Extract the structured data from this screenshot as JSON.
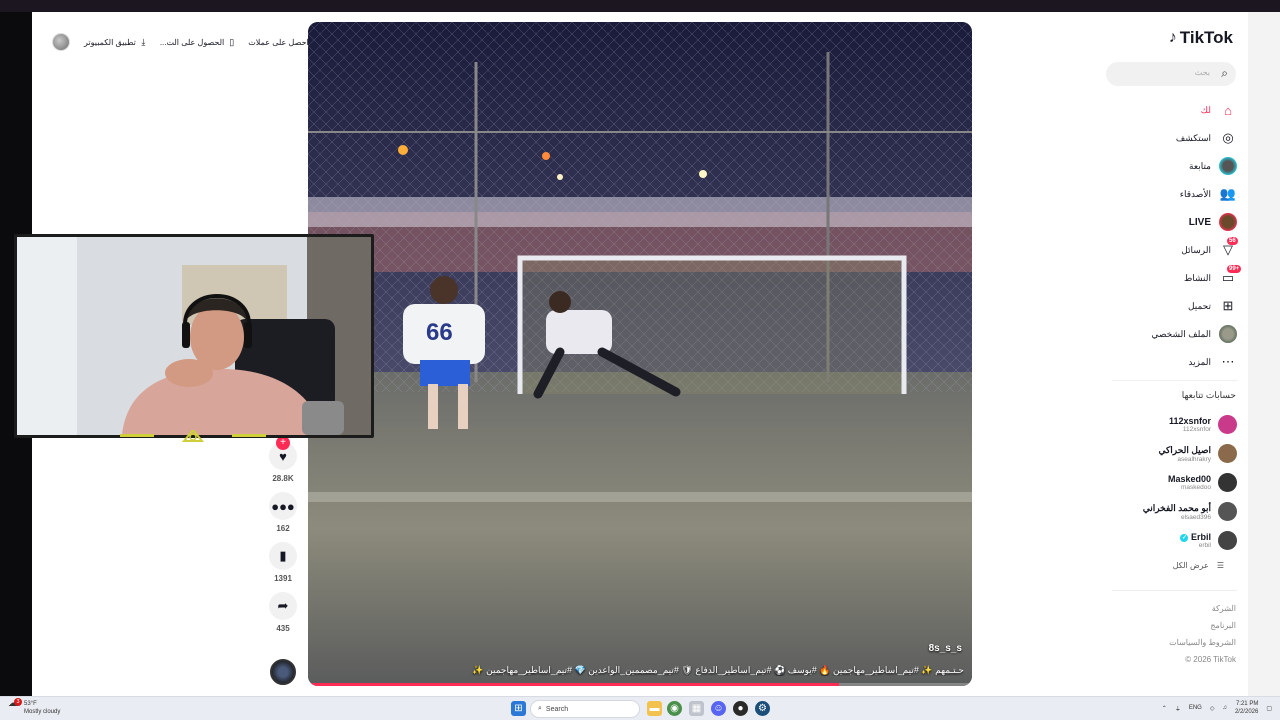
{
  "promo": {
    "get_coins": "احصل على عملات",
    "get_app": "الحصول على الت...",
    "desktop_app": "تطبيق الكمبيوتر"
  },
  "video": {
    "author": "8s_s_s",
    "caption": "حـتـمهم ✨ #تيم_اساطير_مهاجمين 🔥 #يوسف ⚽ #تيم_اساطير_الدفاع 🛡 #تيم_مصممين_الواعدين 💎 #تيم_اساطير_مهاجمين ✨",
    "progress": 0.8,
    "jersey_number": "66"
  },
  "actions": {
    "likes": "28.8K",
    "comments": "162",
    "saves": "1391",
    "shares": "435"
  },
  "sidebar": {
    "logo": "TikTok",
    "search_placeholder": "بحث",
    "nav": [
      {
        "label": "لك",
        "icon": "home-icon"
      },
      {
        "label": "استكشف",
        "icon": "compass-icon"
      },
      {
        "label": "متابعة",
        "icon": "following-avatar-icon"
      },
      {
        "label": "الأصدقاء",
        "icon": "friends-icon"
      },
      {
        "label": "LIVE",
        "icon": "live-icon"
      },
      {
        "label": "الرسائل",
        "icon": "messages-icon",
        "badge": "56"
      },
      {
        "label": "النشاط",
        "icon": "activity-icon",
        "badge": "99+"
      },
      {
        "label": "تحميل",
        "icon": "upload-icon"
      },
      {
        "label": "الملف الشخصي",
        "icon": "profile-icon"
      },
      {
        "label": "المزيد",
        "icon": "more-icon"
      }
    ],
    "following_title": "حسابات تتابعها",
    "accounts": [
      {
        "name": "112xsnfor",
        "handle": "112xsnfor",
        "color": "#c93a8a"
      },
      {
        "name": "اصيل الحراكي",
        "handle": "asealhrakry",
        "color": "#8a6a4a"
      },
      {
        "name": "Masked00",
        "handle": "maskedoo",
        "color": "#333333"
      },
      {
        "name": "أبو محمد الفخراني",
        "handle": "elsaed396",
        "color": "#555555"
      },
      {
        "name": "Erbil",
        "handle": "erbil",
        "color": "#444444"
      }
    ],
    "see_all": "عرض الكل",
    "footer": [
      "الشركة",
      "البرنامج",
      "الشروط والسياسات",
      "© 2026 TikTok"
    ]
  },
  "taskbar": {
    "temperature": "53°F",
    "weather": "Mostly cloudy",
    "weather_badge": "3",
    "search": "Search",
    "lang": "ENG",
    "time": "7:21 PM",
    "date": "2/2/2026"
  },
  "colors": {
    "brand": "#fe2c55",
    "cyan": "#20d5ec",
    "text": "#161823"
  }
}
